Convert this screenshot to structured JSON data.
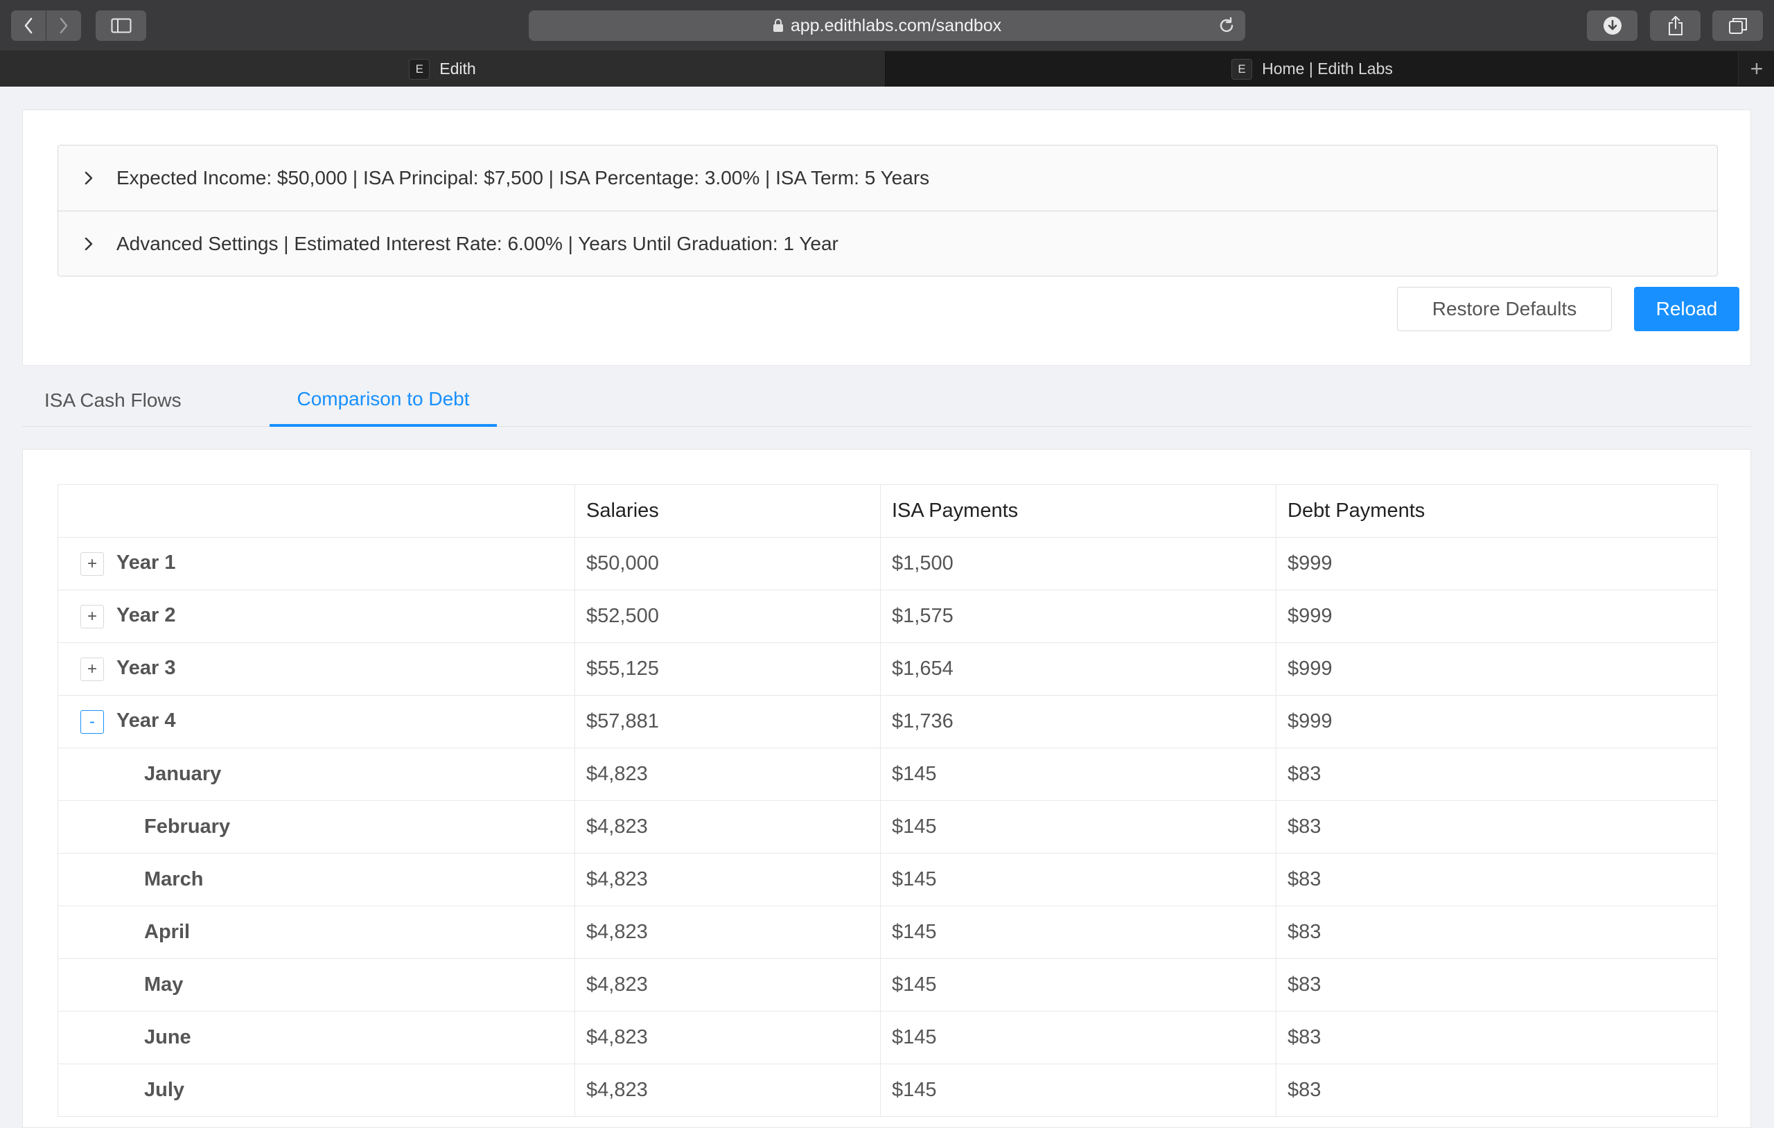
{
  "browser": {
    "url": "app.edithlabs.com/sandbox",
    "tabs": [
      {
        "favicon": "E",
        "title": "Edith"
      },
      {
        "favicon": "E",
        "title": "Home | Edith Labs"
      }
    ],
    "new_tab": "+"
  },
  "settings": {
    "summary": "Expected Income: $50,000 | ISA Principal: $7,500 | ISA Percentage: 3.00% | ISA Term: 5 Years",
    "advanced": "Advanced Settings | Estimated Interest Rate: 6.00% | Years Until Graduation: 1 Year",
    "restore_label": "Restore Defaults",
    "reload_label": "Reload"
  },
  "page_tabs": {
    "cash_flows": "ISA Cash Flows",
    "comparison": "Comparison to Debt"
  },
  "table": {
    "headers": [
      "",
      "Salaries",
      "ISA Payments",
      "Debt Payments"
    ],
    "rows": [
      {
        "label": "Year 1",
        "expander": "+",
        "salaries": "$50,000",
        "isa": "$1,500",
        "debt": "$999"
      },
      {
        "label": "Year 2",
        "expander": "+",
        "salaries": "$52,500",
        "isa": "$1,575",
        "debt": "$999"
      },
      {
        "label": "Year 3",
        "expander": "+",
        "salaries": "$55,125",
        "isa": "$1,654",
        "debt": "$999"
      },
      {
        "label": "Year 4",
        "expander": "-",
        "salaries": "$57,881",
        "isa": "$1,736",
        "debt": "$999"
      },
      {
        "label": "January",
        "salaries": "$4,823",
        "isa": "$145",
        "debt": "$83"
      },
      {
        "label": "February",
        "salaries": "$4,823",
        "isa": "$145",
        "debt": "$83"
      },
      {
        "label": "March",
        "salaries": "$4,823",
        "isa": "$145",
        "debt": "$83"
      },
      {
        "label": "April",
        "salaries": "$4,823",
        "isa": "$145",
        "debt": "$83"
      },
      {
        "label": "May",
        "salaries": "$4,823",
        "isa": "$145",
        "debt": "$83"
      },
      {
        "label": "June",
        "salaries": "$4,823",
        "isa": "$145",
        "debt": "$83"
      },
      {
        "label": "July",
        "salaries": "$4,823",
        "isa": "$145",
        "debt": "$83"
      }
    ]
  },
  "colors": {
    "primary": "#1890ff",
    "chrome": "#3a3a3c"
  }
}
